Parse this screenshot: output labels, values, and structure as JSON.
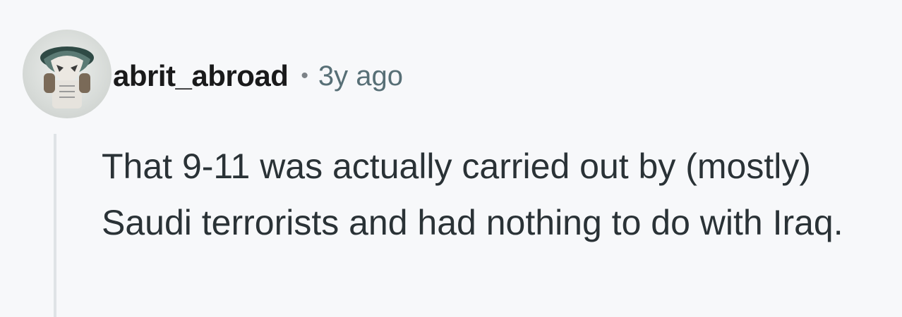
{
  "comment": {
    "username": "abrit_abroad",
    "separator": "•",
    "timestamp": "3y ago",
    "body": "That 9-11 was actually carried out by (mostly) Saudi terrorists and had nothing to do with Iraq.",
    "avatar_icon": "user-avatar-icon"
  },
  "colors": {
    "background": "#f7f8fa",
    "username": "#1a1a1b",
    "timestamp": "#576f76",
    "body_text": "#2a3236",
    "thread_line": "#dfe3e6"
  }
}
